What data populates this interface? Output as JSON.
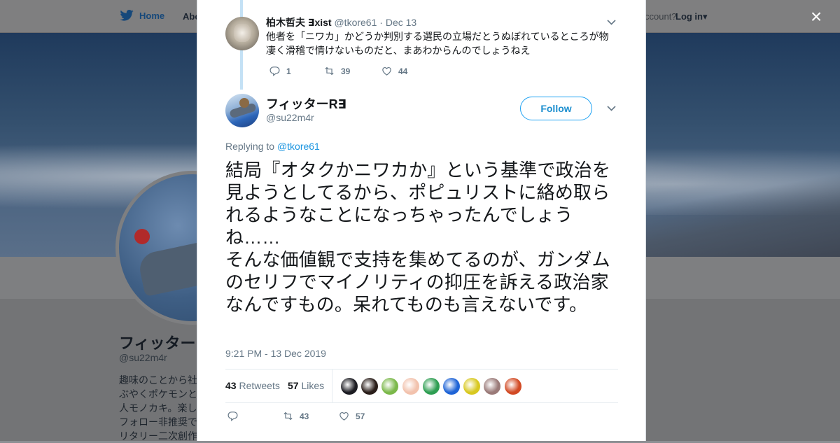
{
  "background": {
    "nav": {
      "home_label": "Home",
      "about_label": "Abo",
      "login_hint": "ccount?",
      "login_label": "Log in"
    },
    "profile": {
      "name": "フィッター",
      "handle": "@su22m4r",
      "bio_lines": "趣味のことから社\nぶやくポケモンと\n人モノカキ。楽し\nフォロー非推奨で\nリタリー二次創作"
    }
  },
  "close_glyph": "×",
  "parent_tweet": {
    "name": "柏木哲夫 ∃xist",
    "handle": "@tkore61",
    "dot": "·",
    "date": "Dec 13",
    "text": "他者を「ニワカ」かどうか判別する選民の立場だとうぬぼれているところが物凄く滑稽で情けないものだと、まあわからんのでしょうねえ",
    "replies": "1",
    "retweets": "39",
    "likes": "44"
  },
  "tweet": {
    "name": "フィッターR∃",
    "handle": "@su22m4r",
    "follow_label": "Follow",
    "replying_prefix": "Replying to",
    "replying_to": "@tkore61",
    "text": "結局『オタクかニワカか』という基準で政治を見ようとしてるから、ポピュリストに絡め取られるようなことになっちゃったんでしょうね……\nそんな価値観で支持を集めてるのが、ガンダムのセリフでマイノリティの抑圧を訴える政治家なんですもの。呆れてものも言えないです。",
    "timestamp": "9:21 PM - 13 Dec 2019",
    "retweet_count": "43",
    "retweet_label": "Retweets",
    "like_count": "57",
    "like_label": "Likes",
    "actions": {
      "replies": "",
      "retweets": "43",
      "likes": "57"
    },
    "likers": [
      "#1c1c22",
      "#2a1e1a",
      "#7bb84a",
      "#f2c2ad",
      "#2e9e52",
      "#1f64d6",
      "#d8c820",
      "#9a7a78",
      "#d24a24"
    ]
  },
  "icons": {
    "reply": "reply-icon",
    "retweet": "retweet-icon",
    "like": "heart-icon",
    "chevron": "chevron-down-icon",
    "close": "close-icon",
    "twitter": "twitter-bird-icon"
  }
}
